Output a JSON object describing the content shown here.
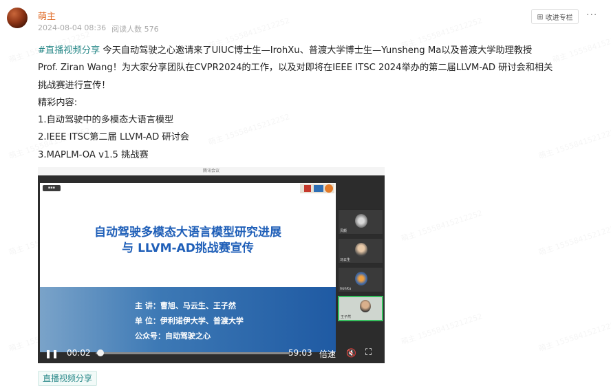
{
  "author": {
    "name": "萌主"
  },
  "meta": {
    "date": "2024-08-04 08:36",
    "reads_label": "阅读人数",
    "reads": "576"
  },
  "actions": {
    "collect": "收进专栏",
    "more": "···"
  },
  "post": {
    "hashtag": "#直播视频分享",
    "line1": " 今天自动驾驶之心邀请来了UIUC博士生—IrohXu、普渡大学博士生—Yunsheng Ma以及普渡大学助理教授",
    "line2": "Prof. Ziran Wang！为大家分享团队在CVPR2024的工作，以及对即将在IEEE ITSC 2024举办的第二届LLVM-AD 研讨会和相关",
    "line3": "挑战赛进行宣传！",
    "highlights_title": "精彩内容:",
    "items": [
      "1.自动驾驶中的多模态大语言模型",
      "2.IEEE ITSC第二届 LLVM-AD 研讨会",
      "3.MAPLM-OA v1.5 挑战赛"
    ]
  },
  "video": {
    "window_title": "腾讯会议",
    "slide": {
      "title_line1": "自动驾驶多模态大语言模型研究进展",
      "title_line2": "与 LLVM-AD挑战赛宣传",
      "speaker": "主  讲：曹旭、马云生、王子然",
      "org": "单  位：伊利诺伊大学、普渡大学",
      "account": "公众号：自动驾驶之心"
    },
    "participants": [
      "贝颜",
      "马云生",
      "IrohXu",
      "王子然"
    ],
    "controls": {
      "current": "00:02",
      "total": "59:03",
      "speed": "倍速",
      "progress": 0.01
    }
  },
  "footer": {
    "tag": "直播视频分享"
  },
  "watermark": "萌主 15558415212252"
}
